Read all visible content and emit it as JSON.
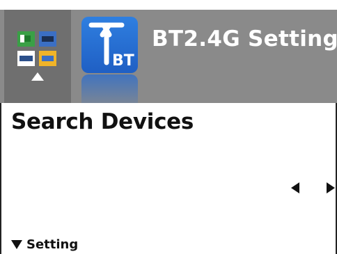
{
  "header": {
    "title": "BT2.4G Setting",
    "app_icon": "bt-antenna-icon",
    "app_icon_text": "BT",
    "menu_icon": "menu-grid-icon",
    "nav_arrow": "up-arrow-icon"
  },
  "page": {
    "title": "Search Devices",
    "prev_icon": "left-arrow-icon",
    "next_icon": "right-arrow-icon"
  },
  "setting": {
    "label": "Setting",
    "icon": "collapse-down-icon"
  },
  "colors": {
    "header_bg": "#8a8a8a",
    "nav_tile_bg": "#6f6f6f",
    "icon_blue": "#2a74d8",
    "text_dark": "#111111",
    "header_text": "#ffffff"
  }
}
